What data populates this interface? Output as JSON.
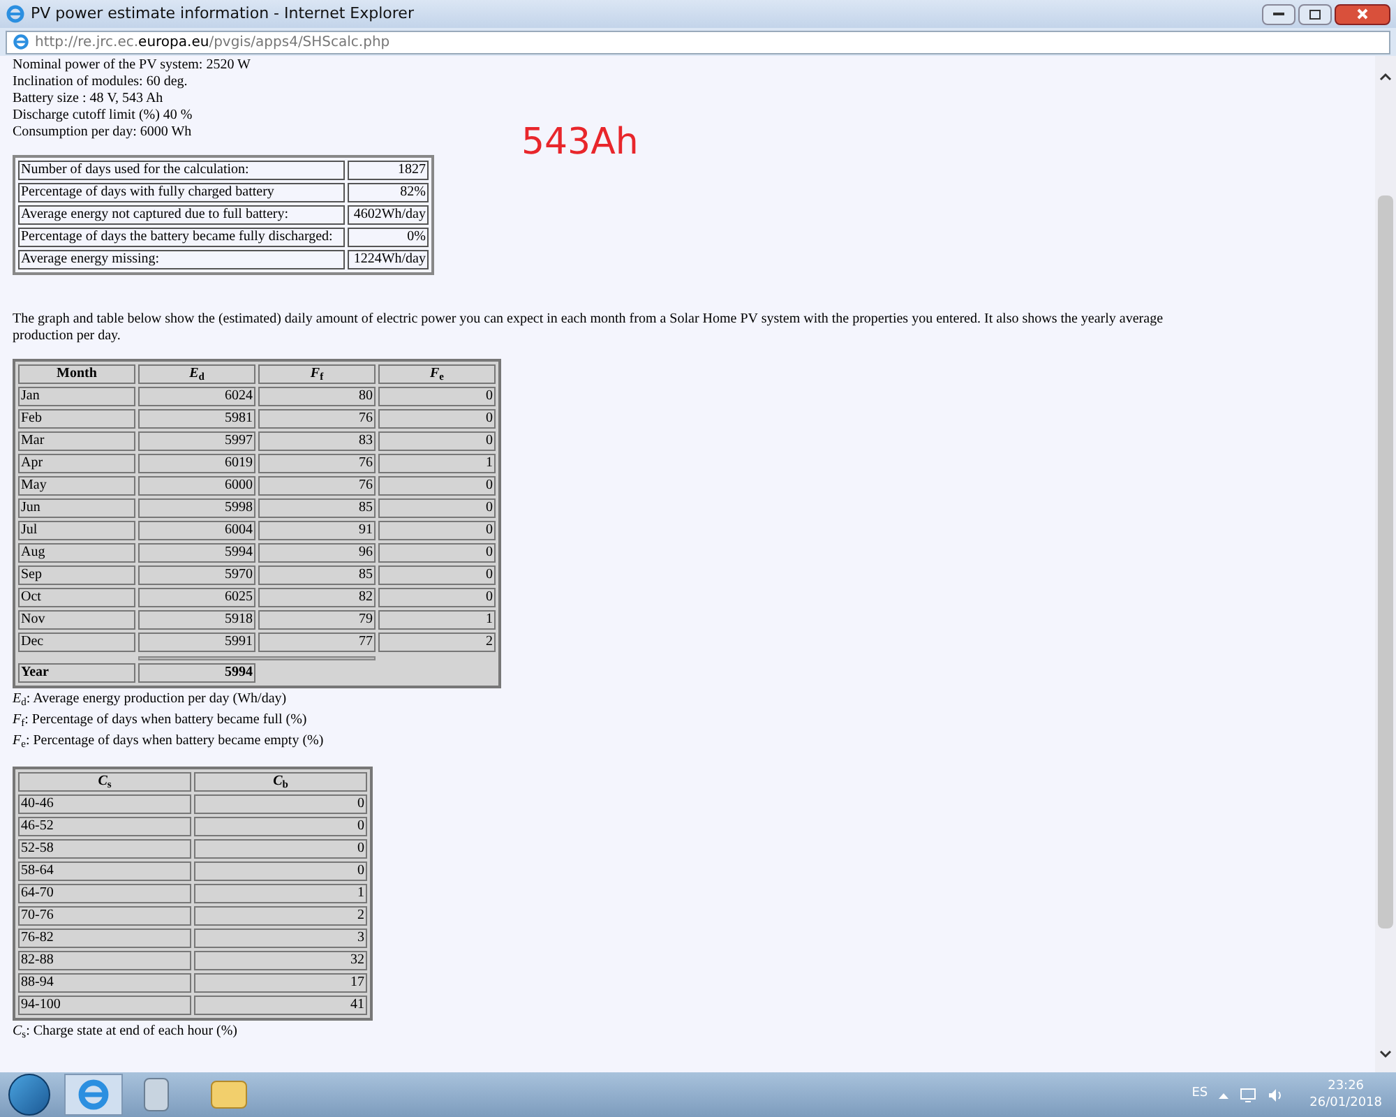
{
  "window": {
    "title": "PV power estimate information - Internet Explorer"
  },
  "address_bar": {
    "prefix": "http://re.jrc.ec.",
    "domain": "europa.eu",
    "suffix": "/pvgis/apps4/SHScalc.php"
  },
  "params": [
    "Nominal power of the PV system: 2520 W",
    "Inclination of modules: 60 deg.",
    "Battery size : 48 V, 543 Ah",
    "Discharge cutoff limit (%) 40 %",
    "Consumption per day: 6000 Wh"
  ],
  "annotation": "543Ah",
  "summary": [
    {
      "label": "Number of days used for the calculation:",
      "value": "1827"
    },
    {
      "label": "Percentage of days with fully charged battery",
      "value": "82%"
    },
    {
      "label": "Average energy not captured due to full battery:",
      "value": "4602Wh/day"
    },
    {
      "label": "Percentage of days the battery became fully discharged:",
      "value": "0%"
    },
    {
      "label": "Average energy missing:",
      "value": "1224Wh/day"
    }
  ],
  "intro": "The graph and table below show the (estimated) daily amount of electric power you can expect in each month from a Solar Home PV system with the properties you entered. It also shows the yearly average production per day.",
  "monthly": {
    "columns": [
      "Month",
      "*E*$_{d}$",
      "*F*$_{f}$",
      "*F*$_{e}$"
    ],
    "rows": [
      [
        "Jan",
        "6024",
        "80",
        "0"
      ],
      [
        "Feb",
        "5981",
        "76",
        "0"
      ],
      [
        "Mar",
        "5997",
        "83",
        "0"
      ],
      [
        "Apr",
        "6019",
        "76",
        "1"
      ],
      [
        "May",
        "6000",
        "76",
        "0"
      ],
      [
        "Jun",
        "5998",
        "85",
        "0"
      ],
      [
        "Jul",
        "6004",
        "91",
        "0"
      ],
      [
        "Aug",
        "5994",
        "96",
        "0"
      ],
      [
        "Sep",
        "5970",
        "85",
        "0"
      ],
      [
        "Oct",
        "6025",
        "82",
        "0"
      ],
      [
        "Nov",
        "5918",
        "79",
        "1"
      ],
      [
        "Dec",
        "5991",
        "77",
        "2"
      ]
    ],
    "year": [
      "Year",
      "5994"
    ]
  },
  "monthly_legend": [
    "*E*$_{d}$: Average energy production per day (Wh/day)",
    "*F*$_{f}$: Percentage of days when battery became full (%)",
    "*F*$_{e}$: Percentage of days when battery became empty (%)"
  ],
  "charge": {
    "columns": [
      "*C*$_{s}$",
      "*C*$_{b}$"
    ],
    "rows": [
      [
        "40-46",
        "0"
      ],
      [
        "46-52",
        "0"
      ],
      [
        "52-58",
        "0"
      ],
      [
        "58-64",
        "0"
      ],
      [
        "64-70",
        "1"
      ],
      [
        "70-76",
        "2"
      ],
      [
        "76-82",
        "3"
      ],
      [
        "82-88",
        "32"
      ],
      [
        "88-94",
        "17"
      ],
      [
        "94-100",
        "41"
      ]
    ]
  },
  "charge_legend": [
    "*C*$_{s}$: Charge state at end of each hour (%)"
  ],
  "taskbar": {
    "language": "ES",
    "time": "23:26",
    "date": "26/01/2018"
  }
}
